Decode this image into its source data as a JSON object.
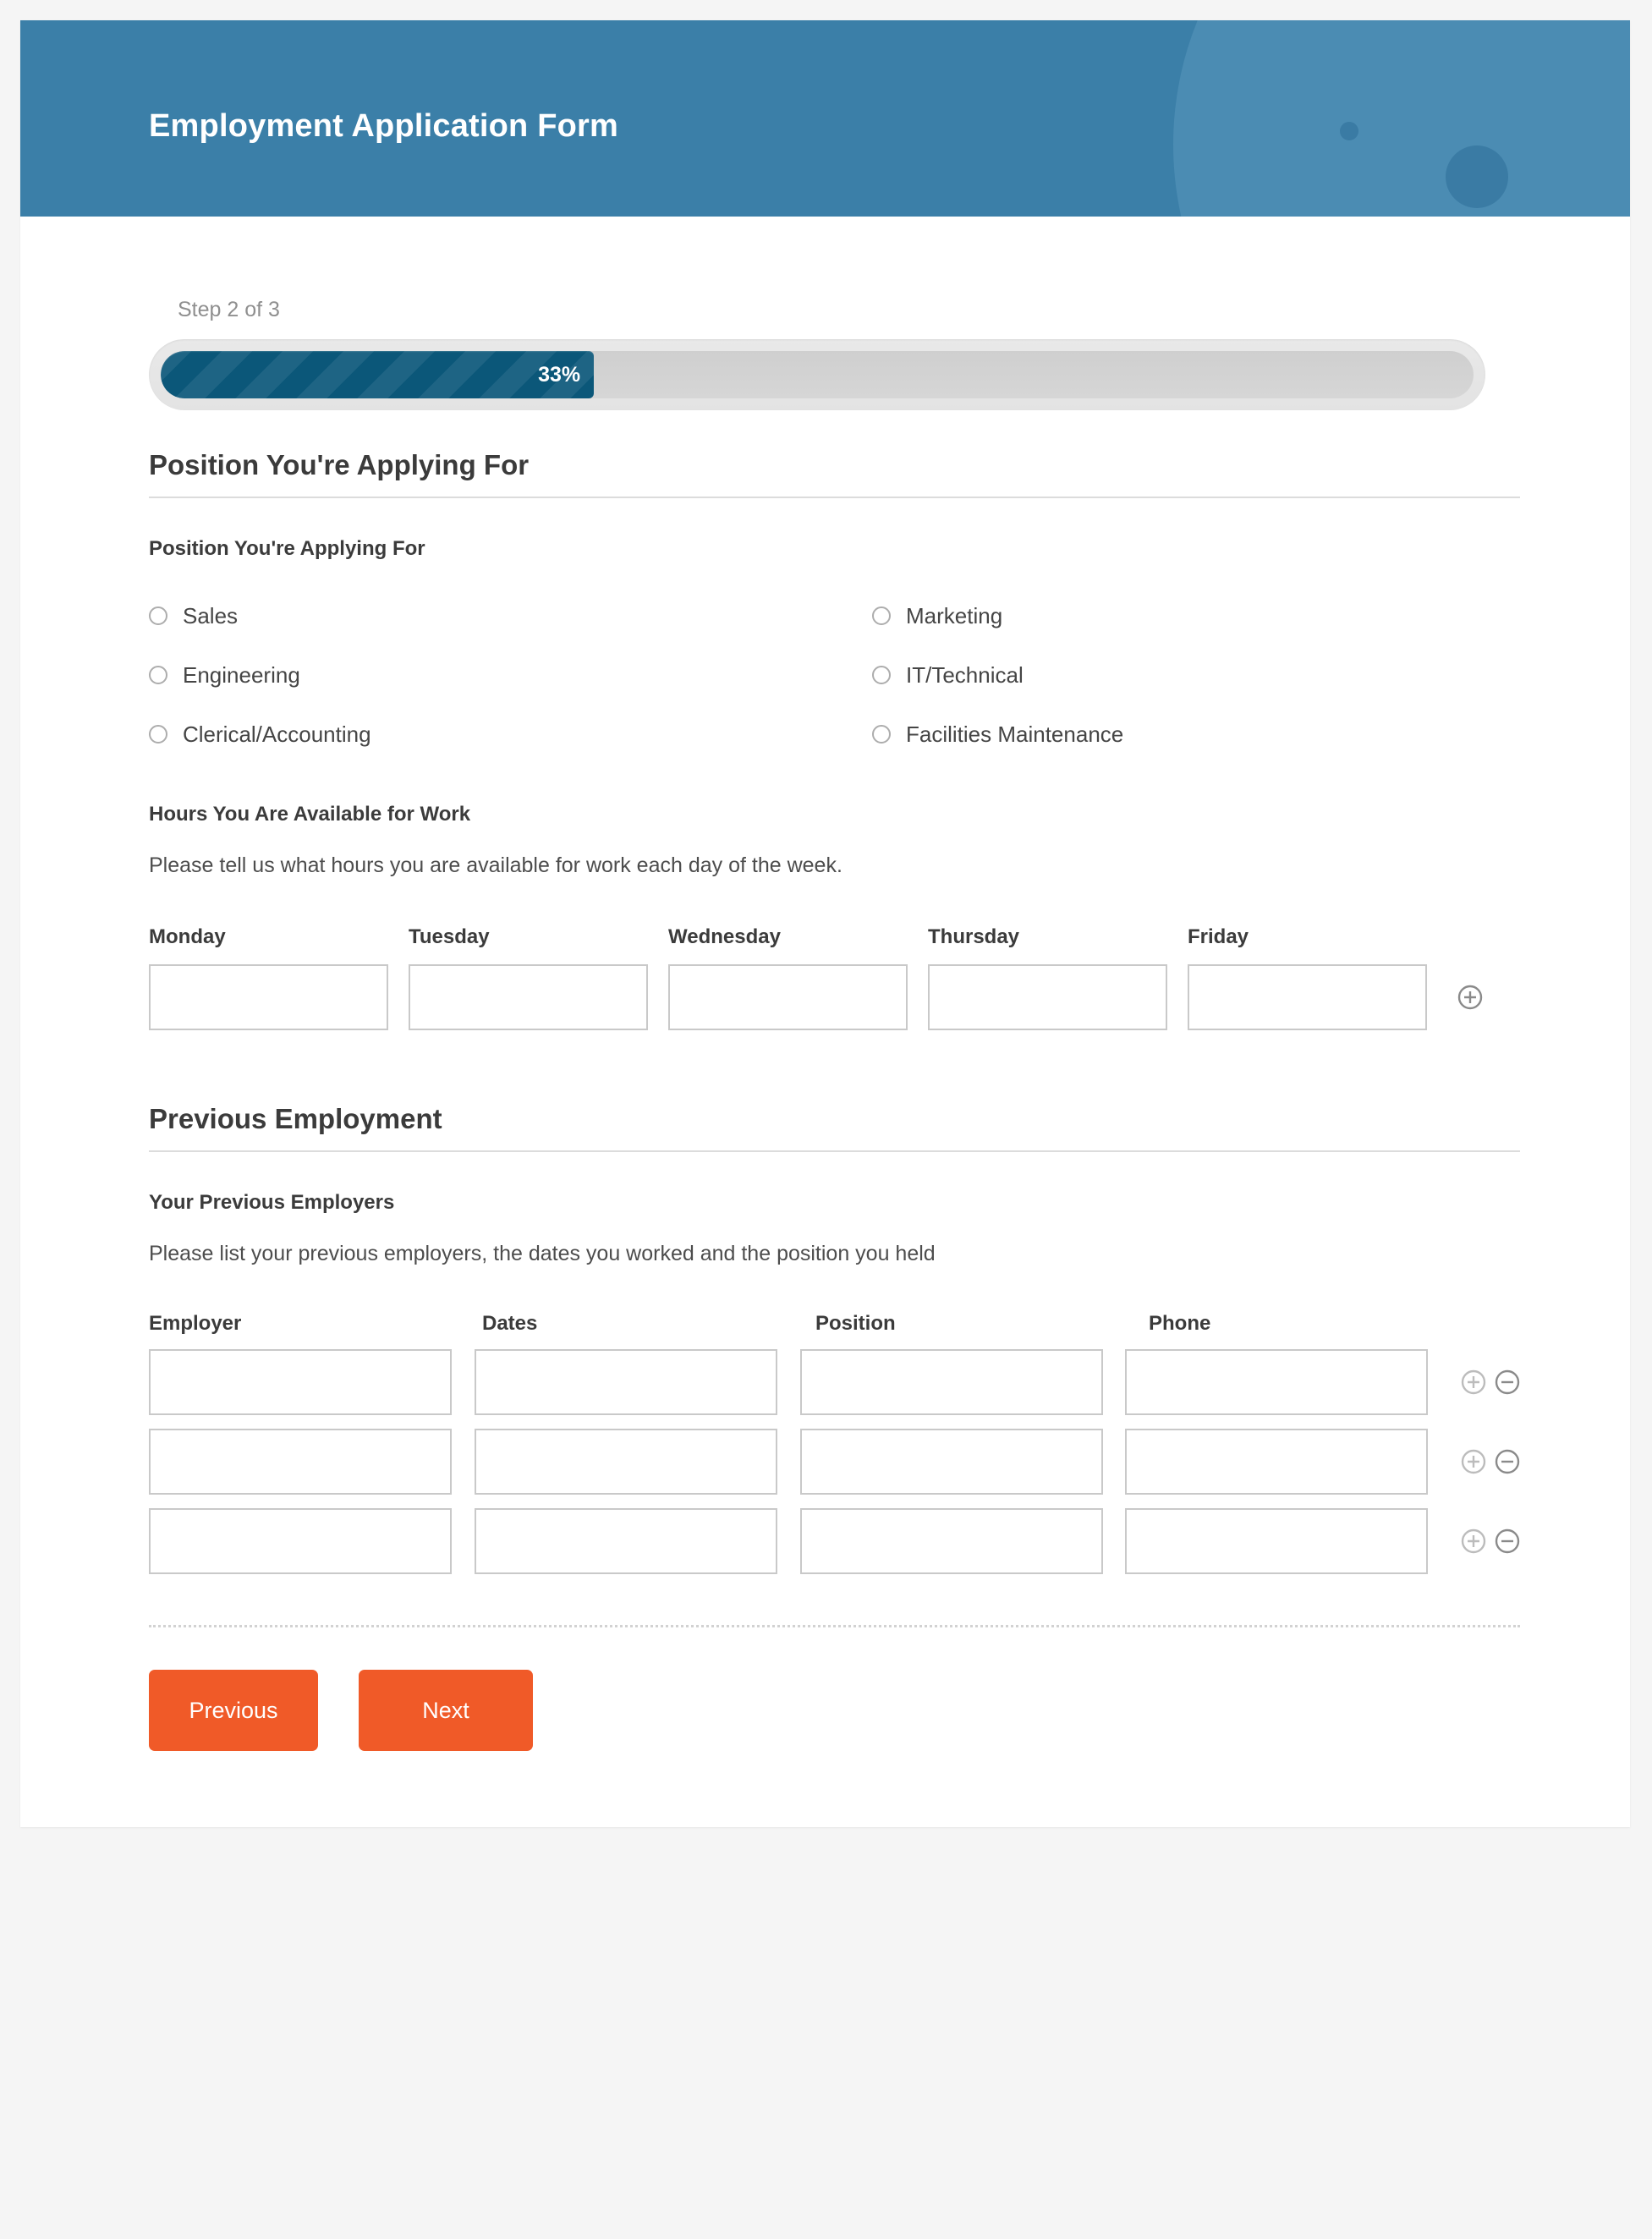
{
  "header": {
    "title": "Employment Application Form",
    "bg_color": "#3b7fa8"
  },
  "progress": {
    "step_label": "Step 2 of 3",
    "percent_label": "33%",
    "percent_value": 33,
    "fill_color": "#0b5779"
  },
  "sections": [
    {
      "heading": "Position You're Applying For",
      "field_label": "Position You're Applying For",
      "options_left": [
        "Sales",
        "Engineering",
        "Clerical/Accounting"
      ],
      "options_right": [
        "Marketing",
        "IT/Technical",
        "Facilities Maintenance"
      ],
      "hours": {
        "label": "Hours You Are Available for Work",
        "description": "Please tell us what hours you are available for work each day of the week.",
        "columns": [
          "Monday",
          "Tuesday",
          "Wednesday",
          "Thursday",
          "Friday"
        ],
        "values": [
          "",
          "",
          "",
          "",
          ""
        ]
      }
    },
    {
      "heading": "Previous Employment",
      "field_label": "Your Previous Employers",
      "description": "Please list your previous employers, the dates you worked and the position you held",
      "columns": [
        "Employer",
        "Dates",
        "Position",
        "Phone"
      ],
      "rows": [
        {
          "employer": "",
          "dates": "",
          "position": "",
          "phone": ""
        },
        {
          "employer": "",
          "dates": "",
          "position": "",
          "phone": ""
        },
        {
          "employer": "",
          "dates": "",
          "position": "",
          "phone": ""
        }
      ]
    }
  ],
  "footer": {
    "previous_label": "Previous",
    "next_label": "Next",
    "button_color": "#f05a28"
  },
  "icons": {
    "add": "plus-circle-icon",
    "remove": "minus-circle-icon"
  }
}
